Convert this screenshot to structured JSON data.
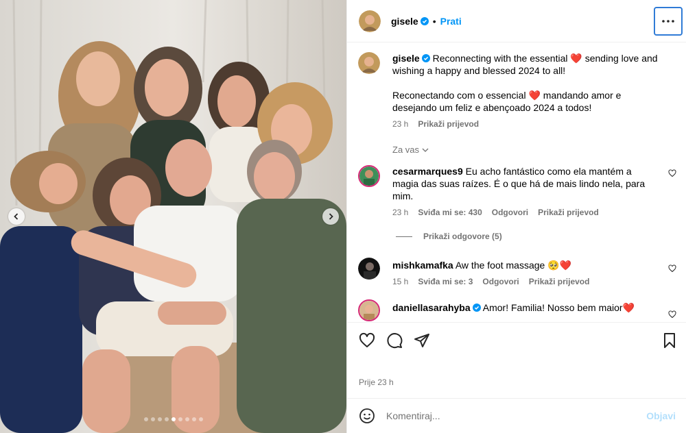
{
  "post": {
    "username": "gisele",
    "follow_label": "Prati",
    "more_label": "···",
    "caption_line1": "Reconnecting with the essential",
    "caption_line1b": "sending love and",
    "caption_line2": "wishing a happy and blessed 2024 to all!",
    "caption_pt1": "Reconectando com o essencial",
    "caption_pt1b": "mandando amor e",
    "caption_pt2": "desejando um feliz e abençoado 2024 a todos!",
    "caption_time": "23 h",
    "caption_translate": "Prikaži prijevod",
    "filter_label": "Za vas",
    "photo_count": 9,
    "photo_index": 4
  },
  "comments": [
    {
      "username": "cesarmarques9",
      "text_l1": "Eu acho fantástico como ela mantém a",
      "text_l2": "magia das suas raízes. É o que há de mais lindo nela, para",
      "text_l3": "mim.",
      "time": "23 h",
      "likes": "Sviđa mi se: 430",
      "reply": "Odgovori",
      "translate": "Prikaži prijevod",
      "view_replies": "Prikaži odgovore (5)"
    },
    {
      "username": "mishkamafka",
      "text": "Aw the foot massage",
      "emoji": "🥺❤️",
      "time": "15 h",
      "likes": "Sviđa mi se: 3",
      "reply": "Odgovori",
      "translate": "Prikaži prijevod"
    },
    {
      "username": "daniellasarahyba",
      "text": "Amor! Familia! Nosso bem maior",
      "emoji": "❤️"
    }
  ],
  "footer": {
    "posted": "Prije 23 h",
    "comment_placeholder": "Komentiraj...",
    "post_label": "Objavi"
  },
  "colors": {
    "accent": "#0095f6",
    "heart": "#e0202e",
    "muted": "#737373"
  }
}
